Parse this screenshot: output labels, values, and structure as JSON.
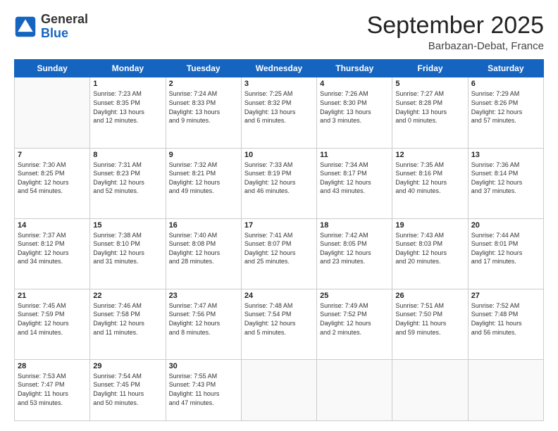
{
  "header": {
    "logo_line1": "General",
    "logo_line2": "Blue",
    "month": "September 2025",
    "location": "Barbazan-Debat, France"
  },
  "weekdays": [
    "Sunday",
    "Monday",
    "Tuesday",
    "Wednesday",
    "Thursday",
    "Friday",
    "Saturday"
  ],
  "rows": [
    [
      {
        "day": "",
        "info": ""
      },
      {
        "day": "1",
        "info": "Sunrise: 7:23 AM\nSunset: 8:35 PM\nDaylight: 13 hours\nand 12 minutes."
      },
      {
        "day": "2",
        "info": "Sunrise: 7:24 AM\nSunset: 8:33 PM\nDaylight: 13 hours\nand 9 minutes."
      },
      {
        "day": "3",
        "info": "Sunrise: 7:25 AM\nSunset: 8:32 PM\nDaylight: 13 hours\nand 6 minutes."
      },
      {
        "day": "4",
        "info": "Sunrise: 7:26 AM\nSunset: 8:30 PM\nDaylight: 13 hours\nand 3 minutes."
      },
      {
        "day": "5",
        "info": "Sunrise: 7:27 AM\nSunset: 8:28 PM\nDaylight: 13 hours\nand 0 minutes."
      },
      {
        "day": "6",
        "info": "Sunrise: 7:29 AM\nSunset: 8:26 PM\nDaylight: 12 hours\nand 57 minutes."
      }
    ],
    [
      {
        "day": "7",
        "info": "Sunrise: 7:30 AM\nSunset: 8:25 PM\nDaylight: 12 hours\nand 54 minutes."
      },
      {
        "day": "8",
        "info": "Sunrise: 7:31 AM\nSunset: 8:23 PM\nDaylight: 12 hours\nand 52 minutes."
      },
      {
        "day": "9",
        "info": "Sunrise: 7:32 AM\nSunset: 8:21 PM\nDaylight: 12 hours\nand 49 minutes."
      },
      {
        "day": "10",
        "info": "Sunrise: 7:33 AM\nSunset: 8:19 PM\nDaylight: 12 hours\nand 46 minutes."
      },
      {
        "day": "11",
        "info": "Sunrise: 7:34 AM\nSunset: 8:17 PM\nDaylight: 12 hours\nand 43 minutes."
      },
      {
        "day": "12",
        "info": "Sunrise: 7:35 AM\nSunset: 8:16 PM\nDaylight: 12 hours\nand 40 minutes."
      },
      {
        "day": "13",
        "info": "Sunrise: 7:36 AM\nSunset: 8:14 PM\nDaylight: 12 hours\nand 37 minutes."
      }
    ],
    [
      {
        "day": "14",
        "info": "Sunrise: 7:37 AM\nSunset: 8:12 PM\nDaylight: 12 hours\nand 34 minutes."
      },
      {
        "day": "15",
        "info": "Sunrise: 7:38 AM\nSunset: 8:10 PM\nDaylight: 12 hours\nand 31 minutes."
      },
      {
        "day": "16",
        "info": "Sunrise: 7:40 AM\nSunset: 8:08 PM\nDaylight: 12 hours\nand 28 minutes."
      },
      {
        "day": "17",
        "info": "Sunrise: 7:41 AM\nSunset: 8:07 PM\nDaylight: 12 hours\nand 25 minutes."
      },
      {
        "day": "18",
        "info": "Sunrise: 7:42 AM\nSunset: 8:05 PM\nDaylight: 12 hours\nand 23 minutes."
      },
      {
        "day": "19",
        "info": "Sunrise: 7:43 AM\nSunset: 8:03 PM\nDaylight: 12 hours\nand 20 minutes."
      },
      {
        "day": "20",
        "info": "Sunrise: 7:44 AM\nSunset: 8:01 PM\nDaylight: 12 hours\nand 17 minutes."
      }
    ],
    [
      {
        "day": "21",
        "info": "Sunrise: 7:45 AM\nSunset: 7:59 PM\nDaylight: 12 hours\nand 14 minutes."
      },
      {
        "day": "22",
        "info": "Sunrise: 7:46 AM\nSunset: 7:58 PM\nDaylight: 12 hours\nand 11 minutes."
      },
      {
        "day": "23",
        "info": "Sunrise: 7:47 AM\nSunset: 7:56 PM\nDaylight: 12 hours\nand 8 minutes."
      },
      {
        "day": "24",
        "info": "Sunrise: 7:48 AM\nSunset: 7:54 PM\nDaylight: 12 hours\nand 5 minutes."
      },
      {
        "day": "25",
        "info": "Sunrise: 7:49 AM\nSunset: 7:52 PM\nDaylight: 12 hours\nand 2 minutes."
      },
      {
        "day": "26",
        "info": "Sunrise: 7:51 AM\nSunset: 7:50 PM\nDaylight: 11 hours\nand 59 minutes."
      },
      {
        "day": "27",
        "info": "Sunrise: 7:52 AM\nSunset: 7:48 PM\nDaylight: 11 hours\nand 56 minutes."
      }
    ],
    [
      {
        "day": "28",
        "info": "Sunrise: 7:53 AM\nSunset: 7:47 PM\nDaylight: 11 hours\nand 53 minutes."
      },
      {
        "day": "29",
        "info": "Sunrise: 7:54 AM\nSunset: 7:45 PM\nDaylight: 11 hours\nand 50 minutes."
      },
      {
        "day": "30",
        "info": "Sunrise: 7:55 AM\nSunset: 7:43 PM\nDaylight: 11 hours\nand 47 minutes."
      },
      {
        "day": "",
        "info": ""
      },
      {
        "day": "",
        "info": ""
      },
      {
        "day": "",
        "info": ""
      },
      {
        "day": "",
        "info": ""
      }
    ]
  ]
}
